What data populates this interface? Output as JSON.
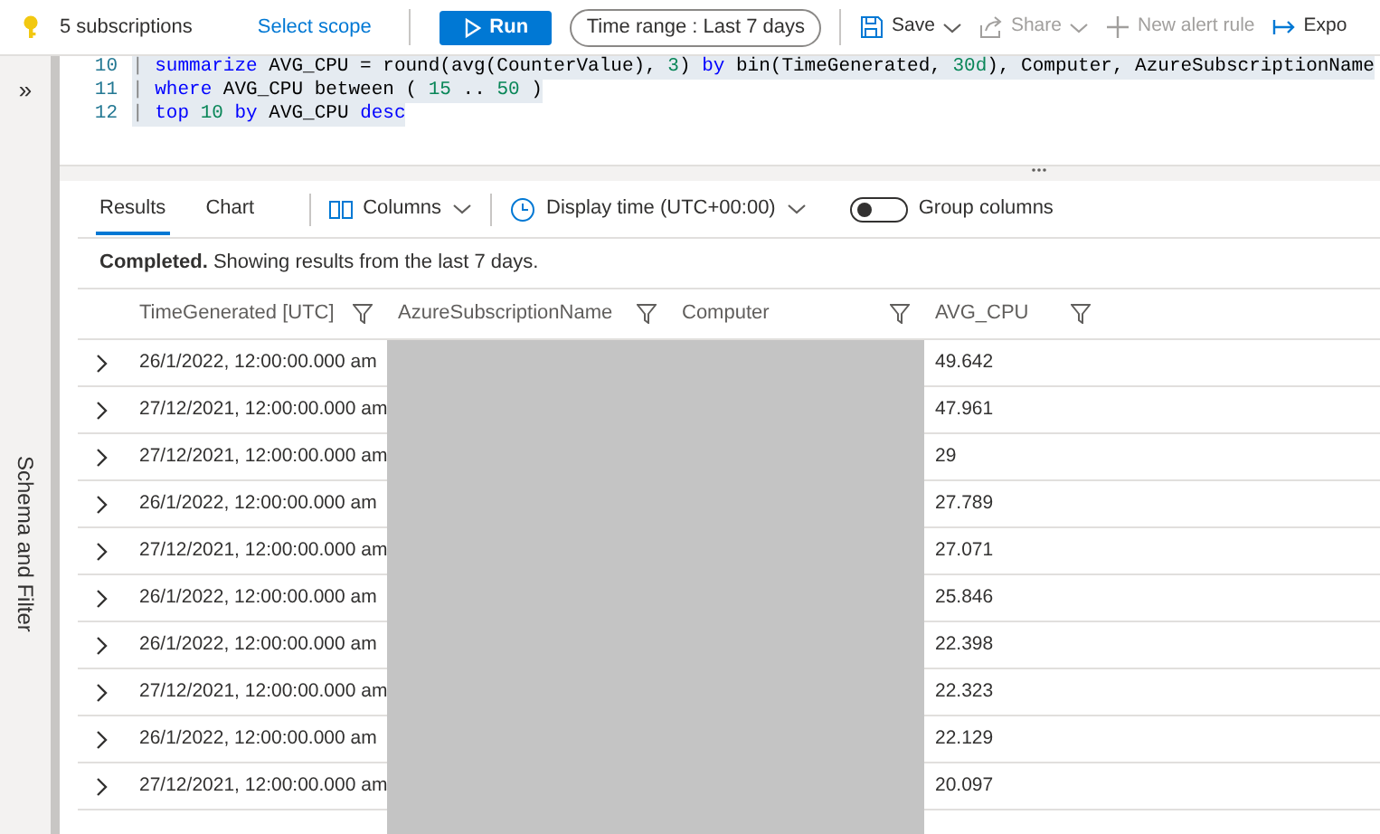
{
  "toolbar": {
    "scope_label": "5 subscriptions",
    "select_scope": "Select scope",
    "run": "Run",
    "time_range": {
      "label": "Time range :",
      "value": "Last 7 days"
    },
    "actions": [
      {
        "label": "Save",
        "kind": "save",
        "chevron": true,
        "disabled": false
      },
      {
        "label": "Share",
        "kind": "share",
        "chevron": true,
        "disabled": true
      },
      {
        "label": "New alert rule",
        "kind": "plus",
        "chevron": false,
        "disabled": true
      },
      {
        "label": "Expo",
        "kind": "export",
        "chevron": false,
        "disabled": false
      }
    ]
  },
  "sidebar": {
    "expand": "»",
    "label": "Schema and Filter"
  },
  "editor": {
    "lines": [
      {
        "number": "10",
        "tokens": [
          {
            "kind": "operator",
            "text": "| "
          },
          {
            "kind": "keyword",
            "text": "summarize"
          },
          {
            "kind": "plain",
            "text": " AVG_CPU = round(avg(CounterValue), "
          },
          {
            "kind": "number",
            "text": "3"
          },
          {
            "kind": "plain",
            "text": ") "
          },
          {
            "kind": "keyword",
            "text": "by"
          },
          {
            "kind": "plain",
            "text": " bin(TimeGenerated, "
          },
          {
            "kind": "number",
            "text": "30d"
          },
          {
            "kind": "plain",
            "text": "), Computer, AzureSubscriptionName"
          }
        ]
      },
      {
        "number": "11",
        "tokens": [
          {
            "kind": "operator",
            "text": "| "
          },
          {
            "kind": "keyword",
            "text": "where"
          },
          {
            "kind": "plain",
            "text": " AVG_CPU between ( "
          },
          {
            "kind": "number",
            "text": "15"
          },
          {
            "kind": "plain",
            "text": " .. "
          },
          {
            "kind": "number",
            "text": "50"
          },
          {
            "kind": "plain",
            "text": " )"
          }
        ]
      },
      {
        "number": "12",
        "tokens": [
          {
            "kind": "operator",
            "text": "| "
          },
          {
            "kind": "keyword",
            "text": "top "
          },
          {
            "kind": "number",
            "text": "10 "
          },
          {
            "kind": "keyword",
            "text": "by"
          },
          {
            "kind": "plain",
            "text": " AVG_CPU "
          },
          {
            "kind": "keyword",
            "text": "desc"
          }
        ]
      }
    ]
  },
  "results": {
    "tabs": [
      {
        "label": "Results",
        "selected": true
      },
      {
        "label": "Chart",
        "selected": false
      }
    ],
    "columns_button": "Columns",
    "display_time": "Display time (UTC+00:00)",
    "group_columns": {
      "label": "Group columns",
      "on": false
    },
    "status": "**Completed.** Showing results from the last 7 days.",
    "table": {
      "columns": [
        "TimeGenerated [UTC]",
        "AzureSubscriptionName",
        "Computer",
        "AVG_CPU"
      ],
      "rows": [
        {
          "time": "26/1/2022, 12:00:00.000 am",
          "avg_cpu": "49.642"
        },
        {
          "time": "27/12/2021, 12:00:00.000 am",
          "avg_cpu": "47.961"
        },
        {
          "time": "27/12/2021, 12:00:00.000 am",
          "avg_cpu": "29"
        },
        {
          "time": "26/1/2022, 12:00:00.000 am",
          "avg_cpu": "27.789"
        },
        {
          "time": "27/12/2021, 12:00:00.000 am",
          "avg_cpu": "27.071"
        },
        {
          "time": "26/1/2022, 12:00:00.000 am",
          "avg_cpu": "25.846"
        },
        {
          "time": "26/1/2022, 12:00:00.000 am",
          "avg_cpu": "22.398"
        },
        {
          "time": "27/12/2021, 12:00:00.000 am",
          "avg_cpu": "22.323"
        },
        {
          "time": "26/1/2022, 12:00:00.000 am",
          "avg_cpu": "22.129"
        },
        {
          "time": "27/12/2021, 12:00:00.000 am",
          "avg_cpu": "20.097"
        }
      ]
    }
  }
}
